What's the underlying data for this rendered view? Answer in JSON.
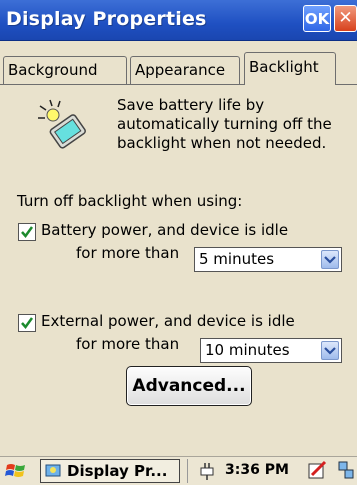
{
  "window": {
    "title": "Display Properties",
    "ok_label": "OK",
    "close_glyph": "✕"
  },
  "tabs": [
    {
      "label": "Background",
      "active": false
    },
    {
      "label": "Appearance",
      "active": false
    },
    {
      "label": "Backlight",
      "active": true
    }
  ],
  "backlight": {
    "description": "Save battery life by automatically turning off the backlight when not needed.",
    "section_label": "Turn off backlight when using:",
    "battery": {
      "checked": true,
      "label_line1": "Battery power, and device is idle",
      "label_line2": "for more than",
      "selected": "5 minutes"
    },
    "external": {
      "checked": true,
      "label_line1": "External power, and device is idle",
      "label_line2": "for more than",
      "selected": "10 minutes"
    },
    "advanced_label": "Advanced..."
  },
  "taskbar": {
    "task_label": "Display Pr...",
    "clock": "3:36 PM"
  },
  "colors": {
    "titlebar": "#1f50c2",
    "dialog_bg": "#e9e2cc",
    "check": "#1c8a2e"
  }
}
